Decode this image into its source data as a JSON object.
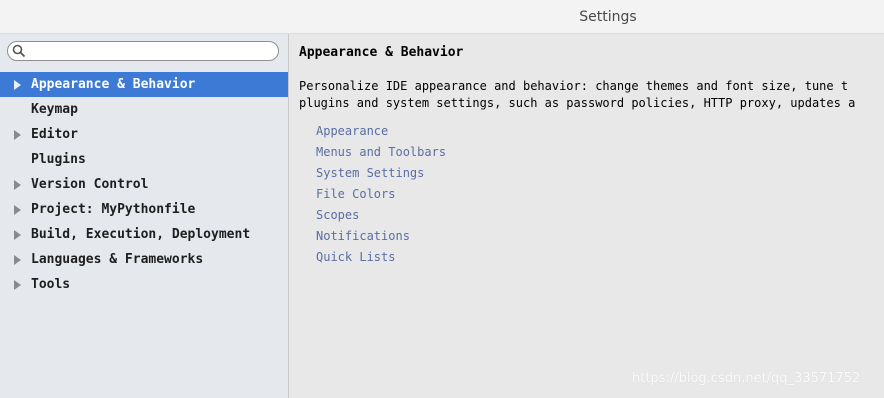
{
  "window": {
    "title": "Settings"
  },
  "search": {
    "value": "",
    "placeholder": ""
  },
  "sidebar": {
    "items": [
      {
        "label": "Appearance & Behavior",
        "expandable": true,
        "selected": true
      },
      {
        "label": "Keymap",
        "expandable": false,
        "selected": false
      },
      {
        "label": "Editor",
        "expandable": true,
        "selected": false
      },
      {
        "label": "Plugins",
        "expandable": false,
        "selected": false
      },
      {
        "label": "Version Control",
        "expandable": true,
        "selected": false
      },
      {
        "label": "Project: MyPythonfile",
        "expandable": true,
        "selected": false
      },
      {
        "label": "Build, Execution, Deployment",
        "expandable": true,
        "selected": false
      },
      {
        "label": "Languages & Frameworks",
        "expandable": true,
        "selected": false
      },
      {
        "label": "Tools",
        "expandable": true,
        "selected": false
      }
    ]
  },
  "main": {
    "heading": "Appearance & Behavior",
    "description_line1": "Personalize IDE appearance and behavior: change themes and font size, tune t",
    "description_line2": "plugins and system settings, such as password policies, HTTP proxy, updates a",
    "links": [
      "Appearance",
      "Menus and Toolbars",
      "System Settings",
      "File Colors",
      "Scopes",
      "Notifications",
      "Quick Lists"
    ]
  },
  "watermark": "https://blog.csdn.net/qq_33571752",
  "colors": {
    "selection": "#3d7ad6",
    "link": "#5b6ea3",
    "sidebar_bg": "#e5e9ed",
    "content_bg": "#e8e8e8"
  },
  "icons": {
    "search": "search-icon",
    "expand": "chevron-right-icon"
  }
}
